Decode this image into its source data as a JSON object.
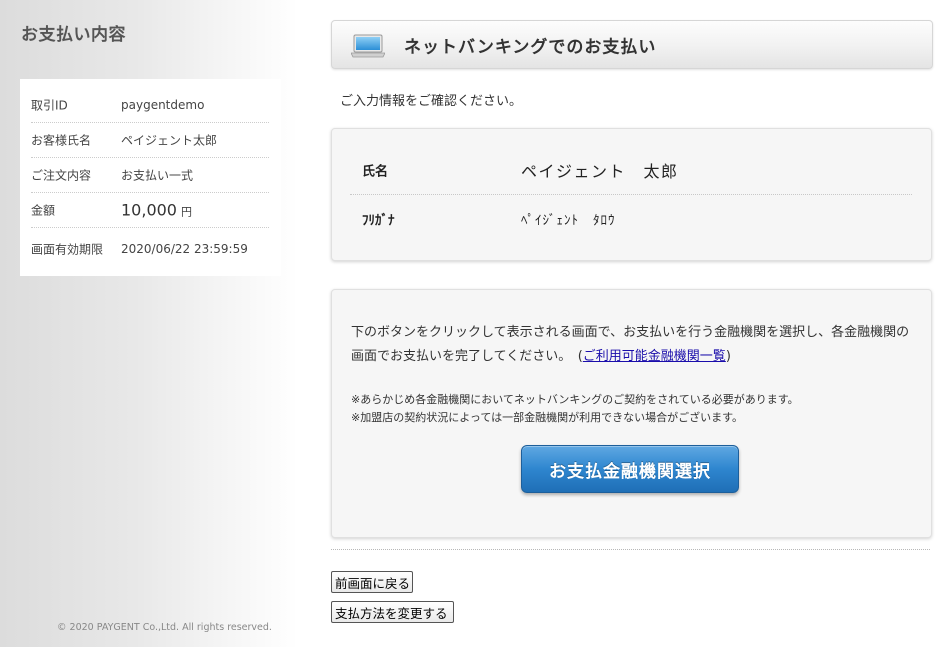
{
  "sidebar": {
    "title": "お支払い内容",
    "summary": {
      "transaction_id": {
        "label": "取引ID",
        "value": "paygentdemo"
      },
      "customer_name": {
        "label": "お客様氏名",
        "value": "ペイジェント太郎"
      },
      "order": {
        "label": "ご注文内容",
        "value": "お支払い一式"
      },
      "amount": {
        "label": "金額",
        "value": "10,000",
        "unit": "円"
      },
      "expiry": {
        "label": "画面有効期限",
        "value": "2020/06/22 23:59:59"
      }
    },
    "copyright": "© 2020 PAYGENT Co.,Ltd. All rights reserved."
  },
  "header": {
    "title": "ネットバンキングでのお支払い",
    "icon": "laptop-icon"
  },
  "intro": "ご入力情報をご確認ください。",
  "customer_info": {
    "name_label": "氏名",
    "name_value": "ペイジェント　太郎",
    "kana_label": "ﾌﾘｶﾞﾅ",
    "kana_value": "ﾍﾟｲｼﾞｪﾝﾄ　ﾀﾛｳ"
  },
  "bank_selection": {
    "description_prefix": "下のボタンをクリックして表示される画面で、お支払いを行う金融機関を選択し、各金融機関の画面でお支払いを完了してください。　(",
    "bank_list_link": "ご利用可能金融機関一覧",
    "description_suffix": ")",
    "note1": "※あらかじめ各金融機関においてネットバンキングのご契約をされている必要があります。",
    "note2": "※加盟店の契約状況によっては一部金融機関が利用できない場合がございます。",
    "select_button": "お支払金融機関選択"
  },
  "actions": {
    "back_button": "前画面に戻る",
    "change_method_button": "支払方法を変更する"
  },
  "colors": {
    "primary_button": "#2e86cf",
    "link": "#1a0dab",
    "sidebar_bg": "#e4e4e4"
  }
}
